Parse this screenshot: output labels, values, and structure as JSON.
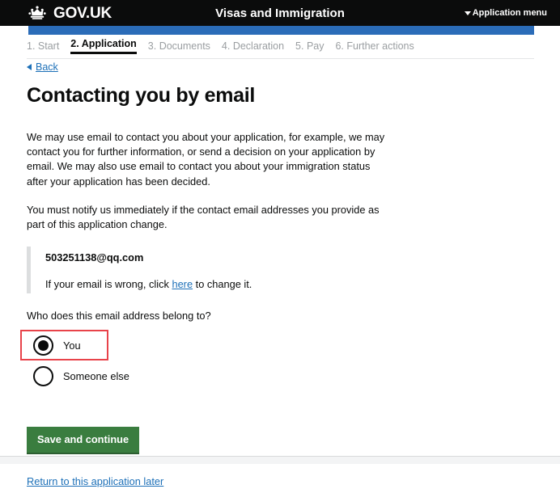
{
  "header": {
    "brand": "GOV.UK",
    "crown_icon": "crown-icon",
    "service_title": "Visas and Immigration",
    "application_menu": "Application menu",
    "menu_caret_icon": "chevron-down-icon"
  },
  "phase_nav": {
    "items": [
      {
        "label": "1. Start",
        "active": false
      },
      {
        "label": "2. Application",
        "active": true
      },
      {
        "label": "3. Documents",
        "active": false
      },
      {
        "label": "4. Declaration",
        "active": false
      },
      {
        "label": "5. Pay",
        "active": false
      },
      {
        "label": "6. Further actions",
        "active": false
      }
    ]
  },
  "back": {
    "label": "Back",
    "icon": "caret-left-icon"
  },
  "main": {
    "page_title": "Contacting you by email",
    "paragraph_1": "We may use email to contact you about your application, for example, we may contact you for further information, or send a decision on your application by email. We may also use email to contact you about your immigration status after your application has been decided.",
    "paragraph_2": "You must notify us immediately if the contact email addresses you provide as part of this application change.",
    "email_value": "503251138@qq.com",
    "email_hint_before": "If your email is wrong, click ",
    "email_hint_link": "here",
    "email_hint_after": " to change it.",
    "radio_question": "Who does this email address belong to?",
    "radio_options": [
      {
        "label": "You",
        "checked": true,
        "highlighted": true
      },
      {
        "label": "Someone else",
        "checked": false,
        "highlighted": false
      }
    ],
    "save_button": "Save and continue",
    "return_link": "Return to this application later"
  },
  "colors": {
    "header_bg": "#0b0c0c",
    "progress_blue": "#2b6cb8",
    "link_blue": "#1d70b8",
    "button_green": "#3a7d3f",
    "highlight_red": "#e8434a",
    "muted_text": "#9a9ea1",
    "inset_border": "#dcdedf"
  }
}
